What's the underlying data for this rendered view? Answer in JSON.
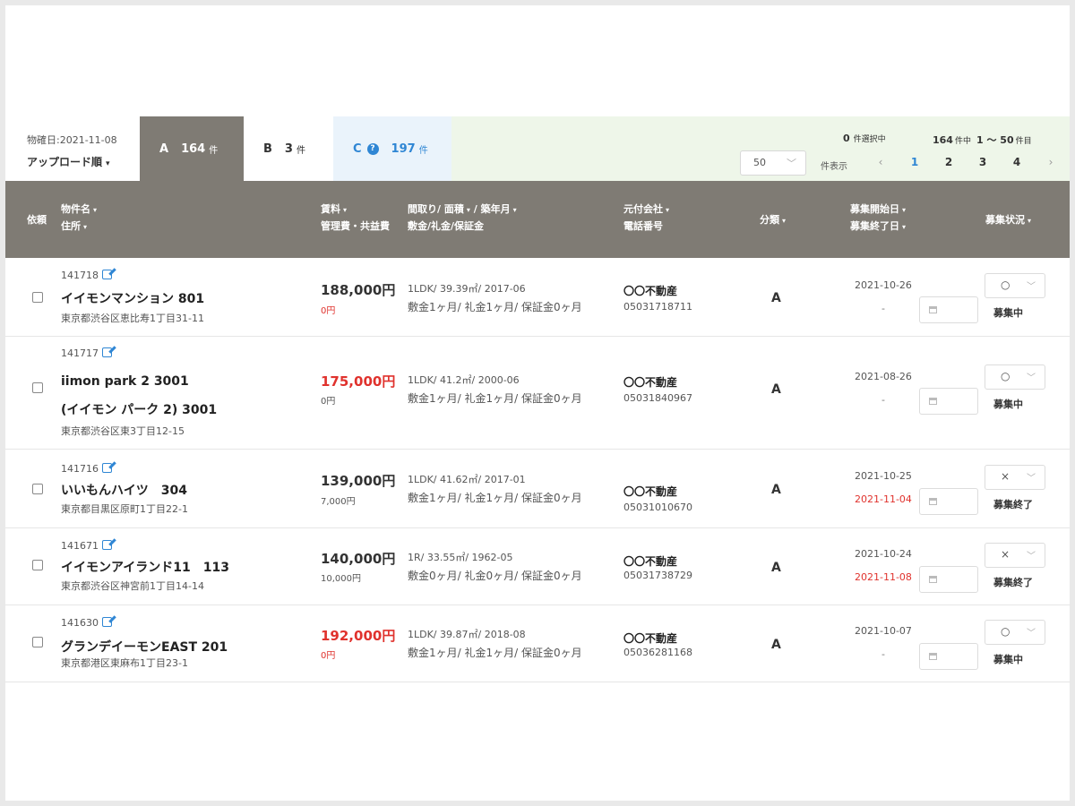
{
  "filter": {
    "upload_date_label": "物確日:2021-11-08",
    "sort_label": "アップロード順",
    "caret": "▾",
    "tabs": [
      {
        "letter": "A",
        "count": "164",
        "unit": "件"
      },
      {
        "letter": "B",
        "count": "3",
        "unit": "件"
      },
      {
        "letter": "C",
        "count": "197",
        "unit": "件",
        "help": "?"
      }
    ],
    "selected_count": "0",
    "selected_unit": "件選択中",
    "total": "164",
    "total_unit": "件中",
    "range": "1 ～ 50",
    "range_unit": "件目",
    "per_page": "50",
    "per_page_label": "件表示",
    "pages": [
      "1",
      "2",
      "3",
      "4"
    ],
    "current_page": "1",
    "prev": "‹",
    "next": "›"
  },
  "columns": {
    "request": "依頼",
    "name": "物件名",
    "address": "住所",
    "rent": "賃料",
    "mgmt": "管理費・共益費",
    "layout": "間取り/ 面積",
    "built": "/ 築年月",
    "deposit": "敷金/礼金/保証金",
    "company": "元付会社",
    "phone": "電話番号",
    "class": "分類",
    "start": "募集開始日",
    "end": "募集終了日",
    "status": "募集状況"
  },
  "rows": [
    {
      "id": "141718",
      "name1": "イイモンマンション 801",
      "name2": "",
      "address": "東京都渋谷区恵比寿1丁目31-11",
      "rent": "188,000円",
      "rent_red": false,
      "mgmt": "0円",
      "mgmt_red": true,
      "layout": "1LDK/ 39.39㎡/ 2017-06",
      "fees": "敷金1ヶ月/ 礼金1ヶ月/ 保証金0ヶ月",
      "company": "〇〇不動産",
      "phone": "05031718711",
      "class": "A",
      "start": "2021-10-26",
      "end": "",
      "end_red": false,
      "status_mark": "○",
      "status": "募集中"
    },
    {
      "id": "141717",
      "name1": "iimon park 2 3001",
      "name2": "(イイモン パーク 2) 3001",
      "address": "東京都渋谷区東3丁目12-15",
      "rent": "175,000円",
      "rent_red": true,
      "mgmt": "0円",
      "mgmt_red": false,
      "layout": "1LDK/ 41.2㎡/ 2000-06",
      "fees": "敷金1ヶ月/ 礼金1ヶ月/ 保証金0ヶ月",
      "company": "〇〇不動産",
      "phone": "05031840967",
      "class": "A",
      "start": "2021-08-26",
      "end": "",
      "end_red": false,
      "status_mark": "○",
      "status": "募集中"
    },
    {
      "id": "141716",
      "name1": "いいもんハイツ　304",
      "name2": "",
      "address": "東京都目黒区原町1丁目22-1",
      "rent": "139,000円",
      "rent_red": false,
      "mgmt": "7,000円",
      "mgmt_red": false,
      "layout": "1LDK/ 41.62㎡/ 2017-01",
      "fees": "敷金1ヶ月/ 礼金1ヶ月/ 保証金0ヶ月",
      "company": "〇〇不動産",
      "phone": "05031010670",
      "class": "A",
      "start": "2021-10-25",
      "end": "2021-11-04",
      "end_red": true,
      "status_mark": "×",
      "status": "募集終了"
    },
    {
      "id": "141671",
      "name1": "イイモンアイランド11　113",
      "name2": "",
      "address": "東京都渋谷区神宮前1丁目14-14",
      "rent": "140,000円",
      "rent_red": false,
      "mgmt": "10,000円",
      "mgmt_red": false,
      "layout": "1R/ 33.55㎡/ 1962-05",
      "fees": "敷金0ヶ月/ 礼金0ヶ月/ 保証金0ヶ月",
      "company": "〇〇不動産",
      "phone": "05031738729",
      "class": "A",
      "start": "2021-10-24",
      "end": "2021-11-08",
      "end_red": true,
      "status_mark": "×",
      "status": "募集終了"
    },
    {
      "id": "141630",
      "name1": "グランデイーモンEAST 201",
      "name2": "",
      "address": "東京都港区東麻布1丁目23-1",
      "rent": "192,000円",
      "rent_red": true,
      "mgmt": "0円",
      "mgmt_red": true,
      "layout": "1LDK/ 39.87㎡/ 2018-08",
      "fees": "敷金1ヶ月/ 礼金1ヶ月/ 保証金0ヶ月",
      "company": "〇〇不動産",
      "phone": "05036281168",
      "class": "A",
      "start": "2021-10-07",
      "end": "",
      "end_red": false,
      "status_mark": "○",
      "status": "募集中"
    }
  ],
  "empty_end": "-",
  "chev": "﹀"
}
